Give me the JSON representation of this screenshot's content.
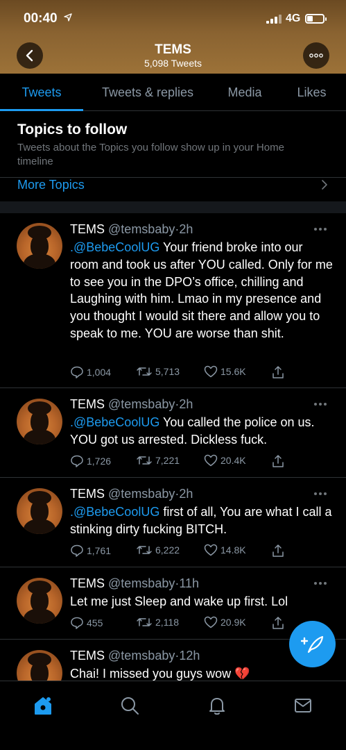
{
  "status_bar": {
    "time": "00:40",
    "network": "4G"
  },
  "header": {
    "name": "TEMS",
    "tweet_count": "5,098 Tweets"
  },
  "tabs": [
    {
      "label": "Tweets",
      "active": true
    },
    {
      "label": "Tweets & replies",
      "active": false
    },
    {
      "label": "Media",
      "active": false
    },
    {
      "label": "Likes",
      "active": false
    }
  ],
  "topics": {
    "title": "Topics to follow",
    "description": "Tweets about the Topics you follow show up in your Home timeline",
    "more_label": "More Topics"
  },
  "tweets": [
    {
      "name": "TEMS",
      "handle": "@temsbaby",
      "sep": "·",
      "time": "2h",
      "mention": ".@BebeCoolUG",
      "text": " Your friend broke into our room and took us after YOU called. Only for me to see you in the DPO’s office, chilling and Laughing with him. Lmao in my presence and you thought I would sit there and allow you to speak to me. YOU are worse than shit.",
      "replies": "1,004",
      "retweets": "5,713",
      "likes": "15.6K"
    },
    {
      "name": "TEMS",
      "handle": "@temsbaby",
      "sep": "·",
      "time": "2h",
      "mention": ".@BebeCoolUG",
      "text": " You called the police on us. YOU got us arrested. Dickless fuck.",
      "replies": "1,726",
      "retweets": "7,221",
      "likes": "20.4K"
    },
    {
      "name": "TEMS",
      "handle": "@temsbaby",
      "sep": "·",
      "time": "2h",
      "mention": ".@BebeCoolUG",
      "text": " first of all, You are what I call a stinking dirty fucking BITCH.",
      "replies": "1,761",
      "retweets": "6,222",
      "likes": "14.8K"
    },
    {
      "name": "TEMS",
      "handle": "@temsbaby",
      "sep": "·",
      "time": "11h",
      "mention": "",
      "text": "Let me just Sleep and wake up first. Lol",
      "replies": "455",
      "retweets": "2,118",
      "likes": "20.9K"
    },
    {
      "name": "TEMS",
      "handle": "@temsbaby",
      "sep": "·",
      "time": "12h",
      "mention": "",
      "text": "Chai! I missed you guys wow 💔",
      "replies": "",
      "retweets": "",
      "likes": ""
    }
  ],
  "icons": {
    "back": "chevron-left-icon",
    "more": "more-horizontal-icon",
    "reply": "comment-icon",
    "retweet": "retweet-icon",
    "like": "heart-icon",
    "share": "share-icon",
    "compose": "compose-feather-icon",
    "home": "home-icon",
    "search": "search-icon",
    "notifications": "bell-icon",
    "messages": "mail-icon"
  },
  "colors": {
    "accent": "#1d9bf0",
    "background": "#000000",
    "header_tint": "#8a6331"
  }
}
